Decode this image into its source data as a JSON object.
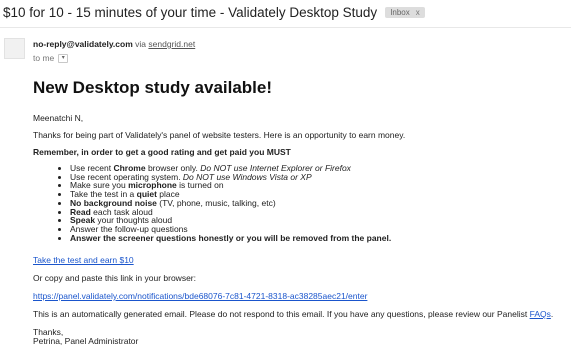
{
  "email": {
    "subject": "$10 for 10 - 15 minutes of your time - Validately Desktop Study",
    "label": "Inbox",
    "label_close": "x",
    "sender_email": "no-reply@validately.com",
    "via_word": "via",
    "via_domain": "sendgrid.net",
    "to": "to me",
    "to_caret": "▾"
  },
  "body": {
    "heading": "New Desktop study available!",
    "greeting": "Meenatchi N,",
    "intro": "Thanks for being part of Validately's panel of website testers. Here is an opportunity to earn money.",
    "remember": "Remember, in order to get a good rating and get paid you MUST",
    "requirements": [
      {
        "pre": "Use recent ",
        "b": "Chrome",
        "post": " browser only. ",
        "i": "Do NOT use Internet Explorer or Firefox"
      },
      {
        "pre": "Use recent operating system. ",
        "b": "",
        "post": "",
        "i": "Do NOT use Windows Vista or XP"
      },
      {
        "pre": "Make sure you ",
        "b": "microphone",
        "post": " is turned on",
        "i": ""
      },
      {
        "pre": "Take the test in a ",
        "b": "quiet",
        "post": " place",
        "i": ""
      },
      {
        "pre": "",
        "b": "No background noise",
        "post": " (TV, phone, music, talking, etc)",
        "i": ""
      },
      {
        "pre": "",
        "b": "Read",
        "post": " each task aloud",
        "i": ""
      },
      {
        "pre": "",
        "b": "Speak",
        "post": " your thoughts aloud",
        "i": ""
      },
      {
        "pre": "Answer the follow-up questions",
        "b": "",
        "post": "",
        "i": ""
      },
      {
        "pre": "",
        "b": "Answer the screener questions honestly or you will be removed from the panel.",
        "post": "",
        "i": ""
      }
    ],
    "cta_link": "Take the test and earn $10",
    "copy_text": "Or copy and paste this link in your browser:",
    "url": "https://panel.validately.com/notifications/bde68076-7c81-4721-8318-ac38285aec21/enter",
    "auto_text": "This is an automatically generated email. Please do not respond to this email. If you have any questions, please review our Panelist ",
    "faqs_link": "FAQs",
    "auto_end": ".",
    "thanks": "Thanks,",
    "signature": "Petrina, Panel Administrator"
  }
}
